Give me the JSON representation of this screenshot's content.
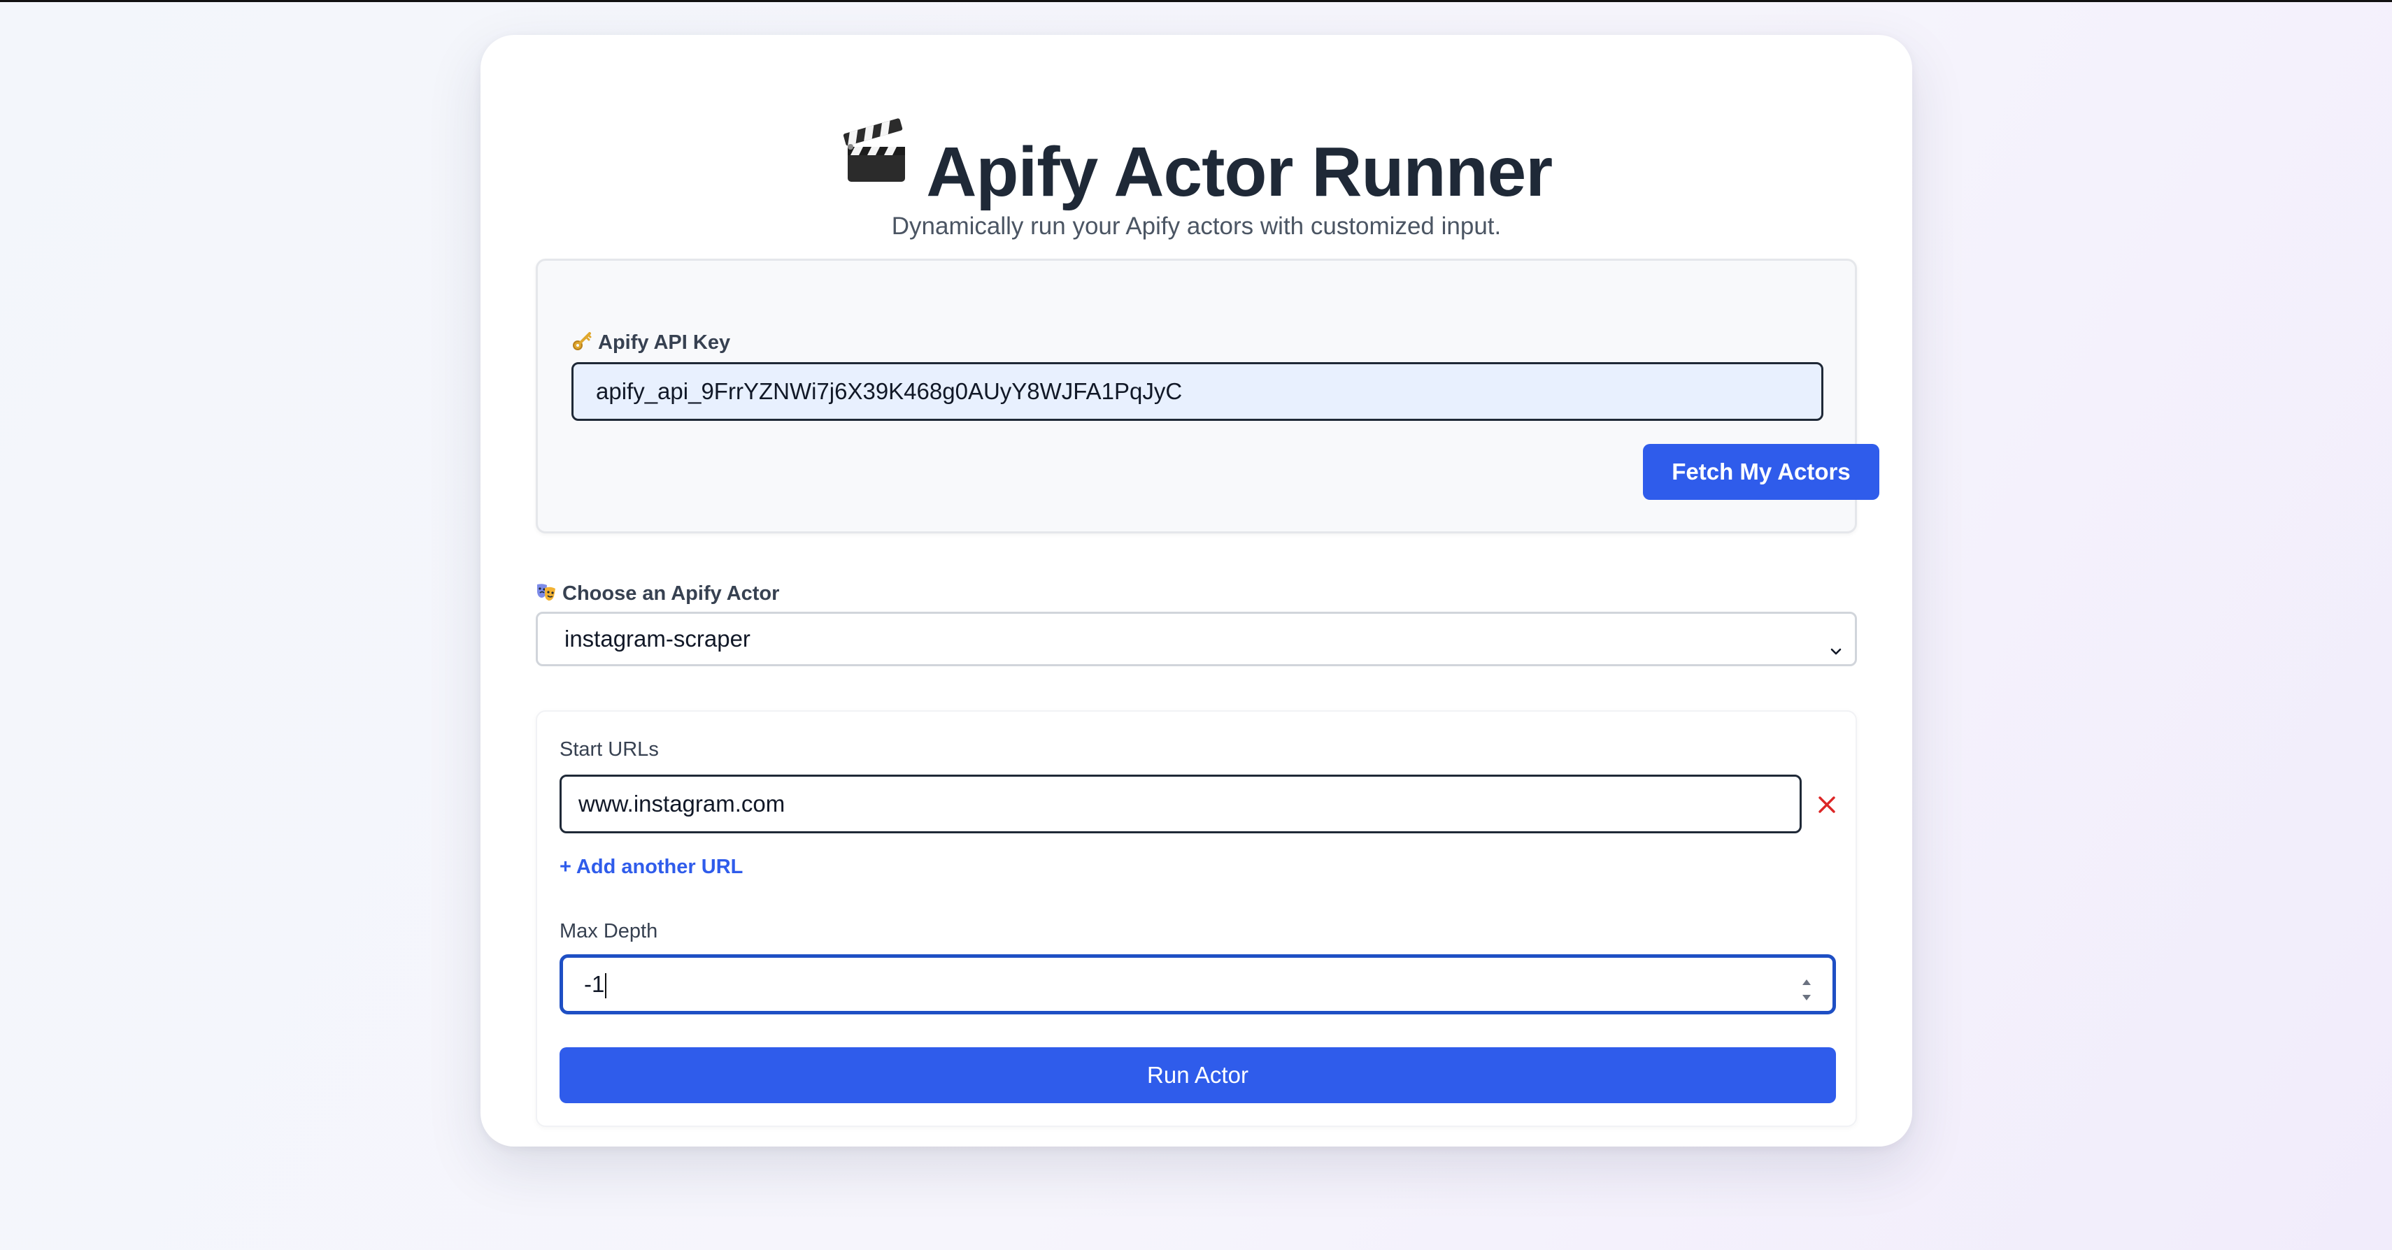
{
  "header": {
    "title": "Apify Actor Runner",
    "title_icon": "clapper-board-icon",
    "subtitle": "Dynamically run your Apify actors with customized input."
  },
  "api_section": {
    "label": "Apify API Key",
    "label_icon": "key-icon",
    "api_key_value": "apify_api_9FrrYZNWi7j6X39K468g0AUyY8WJFA1PqJyC",
    "fetch_button_label": "Fetch My Actors"
  },
  "actor_select": {
    "label": "Choose an Apify Actor",
    "label_icon": "performing-arts-icon",
    "selected_value": "instagram-scraper"
  },
  "actor_form": {
    "start_urls_label": "Start URLs",
    "start_urls": [
      "www.instagram.com"
    ],
    "add_url_label": "+ Add another URL",
    "max_depth_label": "Max Depth",
    "max_depth_value": "-1",
    "run_button_label": "Run Actor"
  },
  "colors": {
    "accent": "#2f5ceb",
    "focus_border": "#1e4fc4",
    "remove_red": "#dc2626",
    "title_text": "#1f2937",
    "autofill_bg": "#e8f0fe"
  }
}
